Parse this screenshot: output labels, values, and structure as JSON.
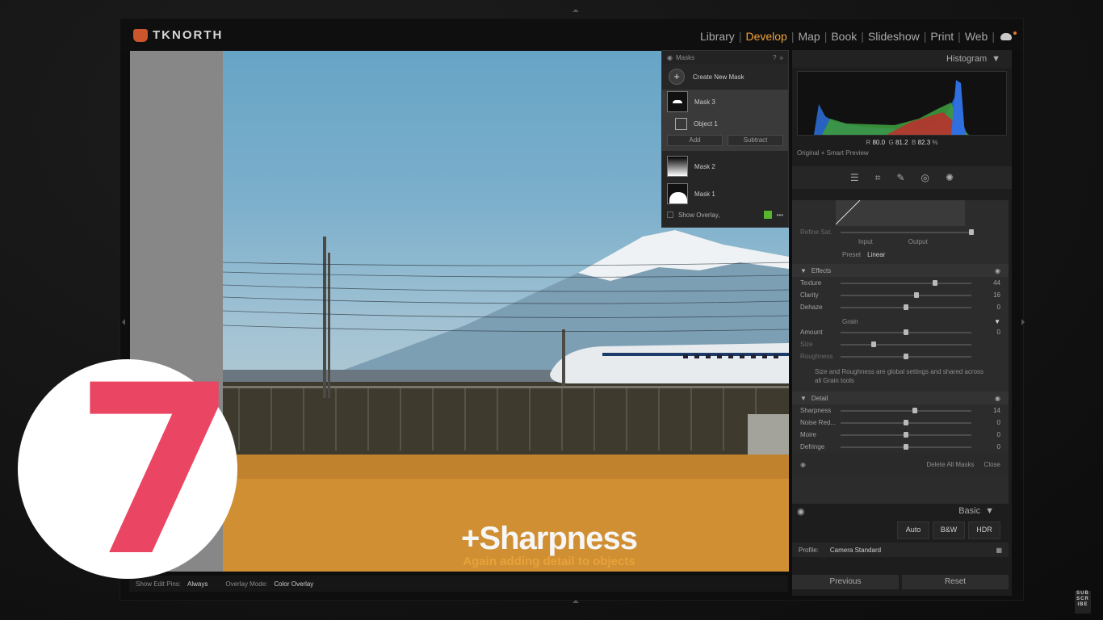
{
  "app": {
    "logo_text": "TKNORTH",
    "accent": "#f0a23a"
  },
  "modules": [
    "Library",
    "Develop",
    "Map",
    "Book",
    "Slideshow",
    "Print",
    "Web"
  ],
  "active_module": "Develop",
  "masks": {
    "title": "Masks",
    "create_label": "Create New Mask",
    "items": [
      {
        "label": "Mask 3",
        "selected": true
      },
      {
        "label": "Object 1"
      },
      {
        "label": "Mask 2"
      },
      {
        "label": "Mask 1"
      }
    ],
    "add_label": "Add",
    "subtract_label": "Subtract",
    "show_overlay_label": "Show Overlay,",
    "overlay_color": "#57b530"
  },
  "histogram": {
    "title": "Histogram",
    "r_label": "R",
    "r_value": "80.0",
    "g_label": "G",
    "g_value": "81.2",
    "b_label": "B",
    "b_value": "82.3",
    "percent": "%",
    "preview_label": "Original + Smart Preview"
  },
  "curve": {
    "input_label": "Input",
    "output_label": "Output",
    "preset_label": "Preset",
    "preset_value": "Linear",
    "refine_label": "Refine Sat."
  },
  "effects": {
    "title": "Effects",
    "rows": [
      {
        "label": "Texture",
        "value": "44",
        "pos": 0.72
      },
      {
        "label": "Clarity",
        "value": "16",
        "pos": 0.58
      },
      {
        "label": "Dehaze",
        "value": "0",
        "pos": 0.5
      }
    ]
  },
  "grain": {
    "title": "Grain",
    "rows": [
      {
        "label": "Amount",
        "value": "0",
        "pos": 0.5
      },
      {
        "label": "Size",
        "value": "",
        "pos": 0.25
      },
      {
        "label": "Roughness",
        "value": "",
        "pos": 0.5
      }
    ],
    "note": "Size and Roughness are global settings and shared across all Grain tools"
  },
  "detail": {
    "title": "Detail",
    "rows": [
      {
        "label": "Sharpness",
        "value": "14",
        "pos": 0.57
      },
      {
        "label": "Noise Red...",
        "value": "0",
        "pos": 0.5
      },
      {
        "label": "Moire",
        "value": "0",
        "pos": 0.5
      },
      {
        "label": "Defringe",
        "value": "0",
        "pos": 0.5
      }
    ]
  },
  "panel_footer": {
    "delete_all": "Delete All Masks",
    "close": "Close"
  },
  "basic": {
    "title": "Basic",
    "auto": "Auto",
    "bw": "B&W",
    "hdr": "HDR",
    "profile_label": "Profile:",
    "profile_value": "Camera Standard"
  },
  "bottom_buttons": {
    "previous": "Previous",
    "reset": "Reset"
  },
  "toolbar": {
    "edit_pins_label": "Show Edit Pins:",
    "edit_pins_value": "Always",
    "overlay_mode_label": "Overlay Mode:",
    "overlay_mode_value": "Color Overlay"
  },
  "caption": {
    "title": "+Sharpness",
    "subtitle": "Again adding detail to objects"
  },
  "badge": {
    "number": "7",
    "color": "#ea4563"
  },
  "subscribe": "SUB SCR IBE"
}
